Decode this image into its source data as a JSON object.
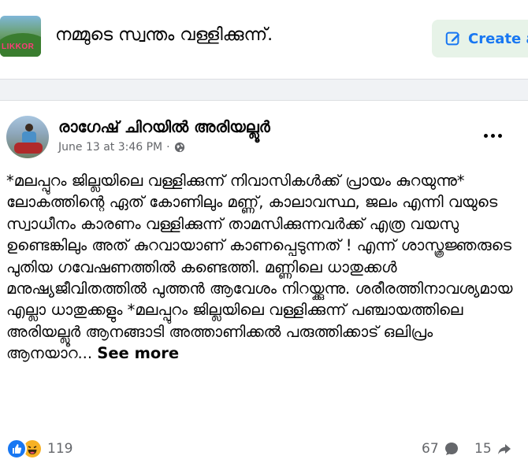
{
  "group": {
    "thumbnail_text": "LIKKOR",
    "name": "നമ്മുടെ സ്വന്തം വള്ളിക്കുന്ന്.",
    "create_label": "Create a"
  },
  "post": {
    "author": "രാഗേഷ് ചിറയിൽ അരിയല്ലൂർ",
    "date": "June 13 at 3:46 PM",
    "separator": "·",
    "text": "*മലപ്പുറം ജില്ലയിലെ വള്ളിക്കുന്ന് നിവാസികൾക്ക്  പ്രായം കുറയുന്നു*\nലോകത്തിന്റെ ഏത് കോണിലും   മണ്ണ്, കാലാവസ്ഥ, ജലം എന്നി വയുടെ സ്വാധീനം കാരണം വള്ളിക്കുന്ന് താമസിക്കുന്നവർക്ക് എത്ര വയസു ഉണ്ടെങ്കിലും അത് കുറവായാണ്  കാണപ്പെടുന്നത് ! എന്ന് ശാസ്ത്രജ്ഞരുടെ പുതിയ ഗവേഷണത്തിൽ കണ്ടെത്തി. മണ്ണിലെ ധാതുക്കൾ മനുഷ്യജീവിതത്തിൽ പുത്തൻ ആവേശം നിറയ്ക്കുന്നു. ശരീരത്തിനാവശ്യമായ എല്ലാ ധാതുക്കളും *മലപ്പുറം ജില്ലയിലെ വള്ളിക്കുന്ന് പഞ്ചായത്തിലെ അരിയല്ലൂർ ആനങ്ങാടി അത്താണിക്കൽ  പരുത്തിക്കാട് ഒലിപ്രം ആനയാറ...",
    "see_more": "See more"
  },
  "engagement": {
    "reactions": "119",
    "comments": "67",
    "shares": "15"
  },
  "colors": {
    "accent": "#1877f2",
    "create_bg": "#e7f3e8",
    "muted_text": "#65676b",
    "page_bg": "#f0f2f5"
  }
}
